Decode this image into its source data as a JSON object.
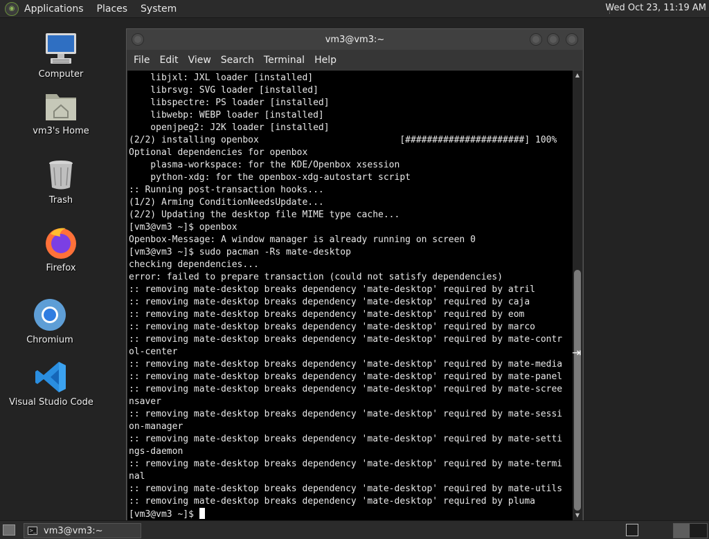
{
  "top_panel": {
    "menus": [
      "Applications",
      "Places",
      "System"
    ],
    "clock": "Wed Oct 23, 11:19 AM"
  },
  "desktop_icons": [
    {
      "label": "Computer",
      "icon": "computer-icon"
    },
    {
      "label": "vm3's Home",
      "icon": "home-folder-icon"
    },
    {
      "label": "Trash",
      "icon": "trash-icon"
    },
    {
      "label": "Firefox",
      "icon": "firefox-icon"
    },
    {
      "label": "Chromium",
      "icon": "chromium-icon"
    },
    {
      "label": "Visual Studio Code",
      "icon": "vscode-icon"
    }
  ],
  "terminal": {
    "title": "vm3@vm3:~",
    "menu": [
      "File",
      "Edit",
      "View",
      "Search",
      "Terminal",
      "Help"
    ],
    "lines": [
      "    libjxl: JXL loader [installed]",
      "    librsvg: SVG loader [installed]",
      "    libspectre: PS loader [installed]",
      "    libwebp: WEBP loader [installed]",
      "    openjpeg2: J2K loader [installed]",
      "(2/2) installing openbox                          [######################] 100%",
      "Optional dependencies for openbox",
      "    plasma-workspace: for the KDE/Openbox xsession",
      "    python-xdg: for the openbox-xdg-autostart script",
      ":: Running post-transaction hooks...",
      "(1/2) Arming ConditionNeedsUpdate...",
      "(2/2) Updating the desktop file MIME type cache...",
      "[vm3@vm3 ~]$ openbox",
      "Openbox-Message: A window manager is already running on screen 0",
      "[vm3@vm3 ~]$ sudo pacman -Rs mate-desktop",
      "checking dependencies...",
      "error: failed to prepare transaction (could not satisfy dependencies)",
      ":: removing mate-desktop breaks dependency 'mate-desktop' required by atril",
      ":: removing mate-desktop breaks dependency 'mate-desktop' required by caja",
      ":: removing mate-desktop breaks dependency 'mate-desktop' required by eom",
      ":: removing mate-desktop breaks dependency 'mate-desktop' required by marco",
      ":: removing mate-desktop breaks dependency 'mate-desktop' required by mate-contr",
      "ol-center",
      ":: removing mate-desktop breaks dependency 'mate-desktop' required by mate-media",
      ":: removing mate-desktop breaks dependency 'mate-desktop' required by mate-panel",
      ":: removing mate-desktop breaks dependency 'mate-desktop' required by mate-scree",
      "nsaver",
      ":: removing mate-desktop breaks dependency 'mate-desktop' required by mate-sessi",
      "on-manager",
      ":: removing mate-desktop breaks dependency 'mate-desktop' required by mate-setti",
      "ngs-daemon",
      ":: removing mate-desktop breaks dependency 'mate-desktop' required by mate-termi",
      "nal",
      ":: removing mate-desktop breaks dependency 'mate-desktop' required by mate-utils",
      ":: removing mate-desktop breaks dependency 'mate-desktop' required by pluma"
    ],
    "prompt": "[vm3@vm3 ~]$ "
  },
  "taskbar": {
    "window_button": "vm3@vm3:~"
  },
  "colors": {
    "desktop_bg": "#232323",
    "terminal_bg": "#000000",
    "terminal_fg": "#e8e8e8"
  }
}
